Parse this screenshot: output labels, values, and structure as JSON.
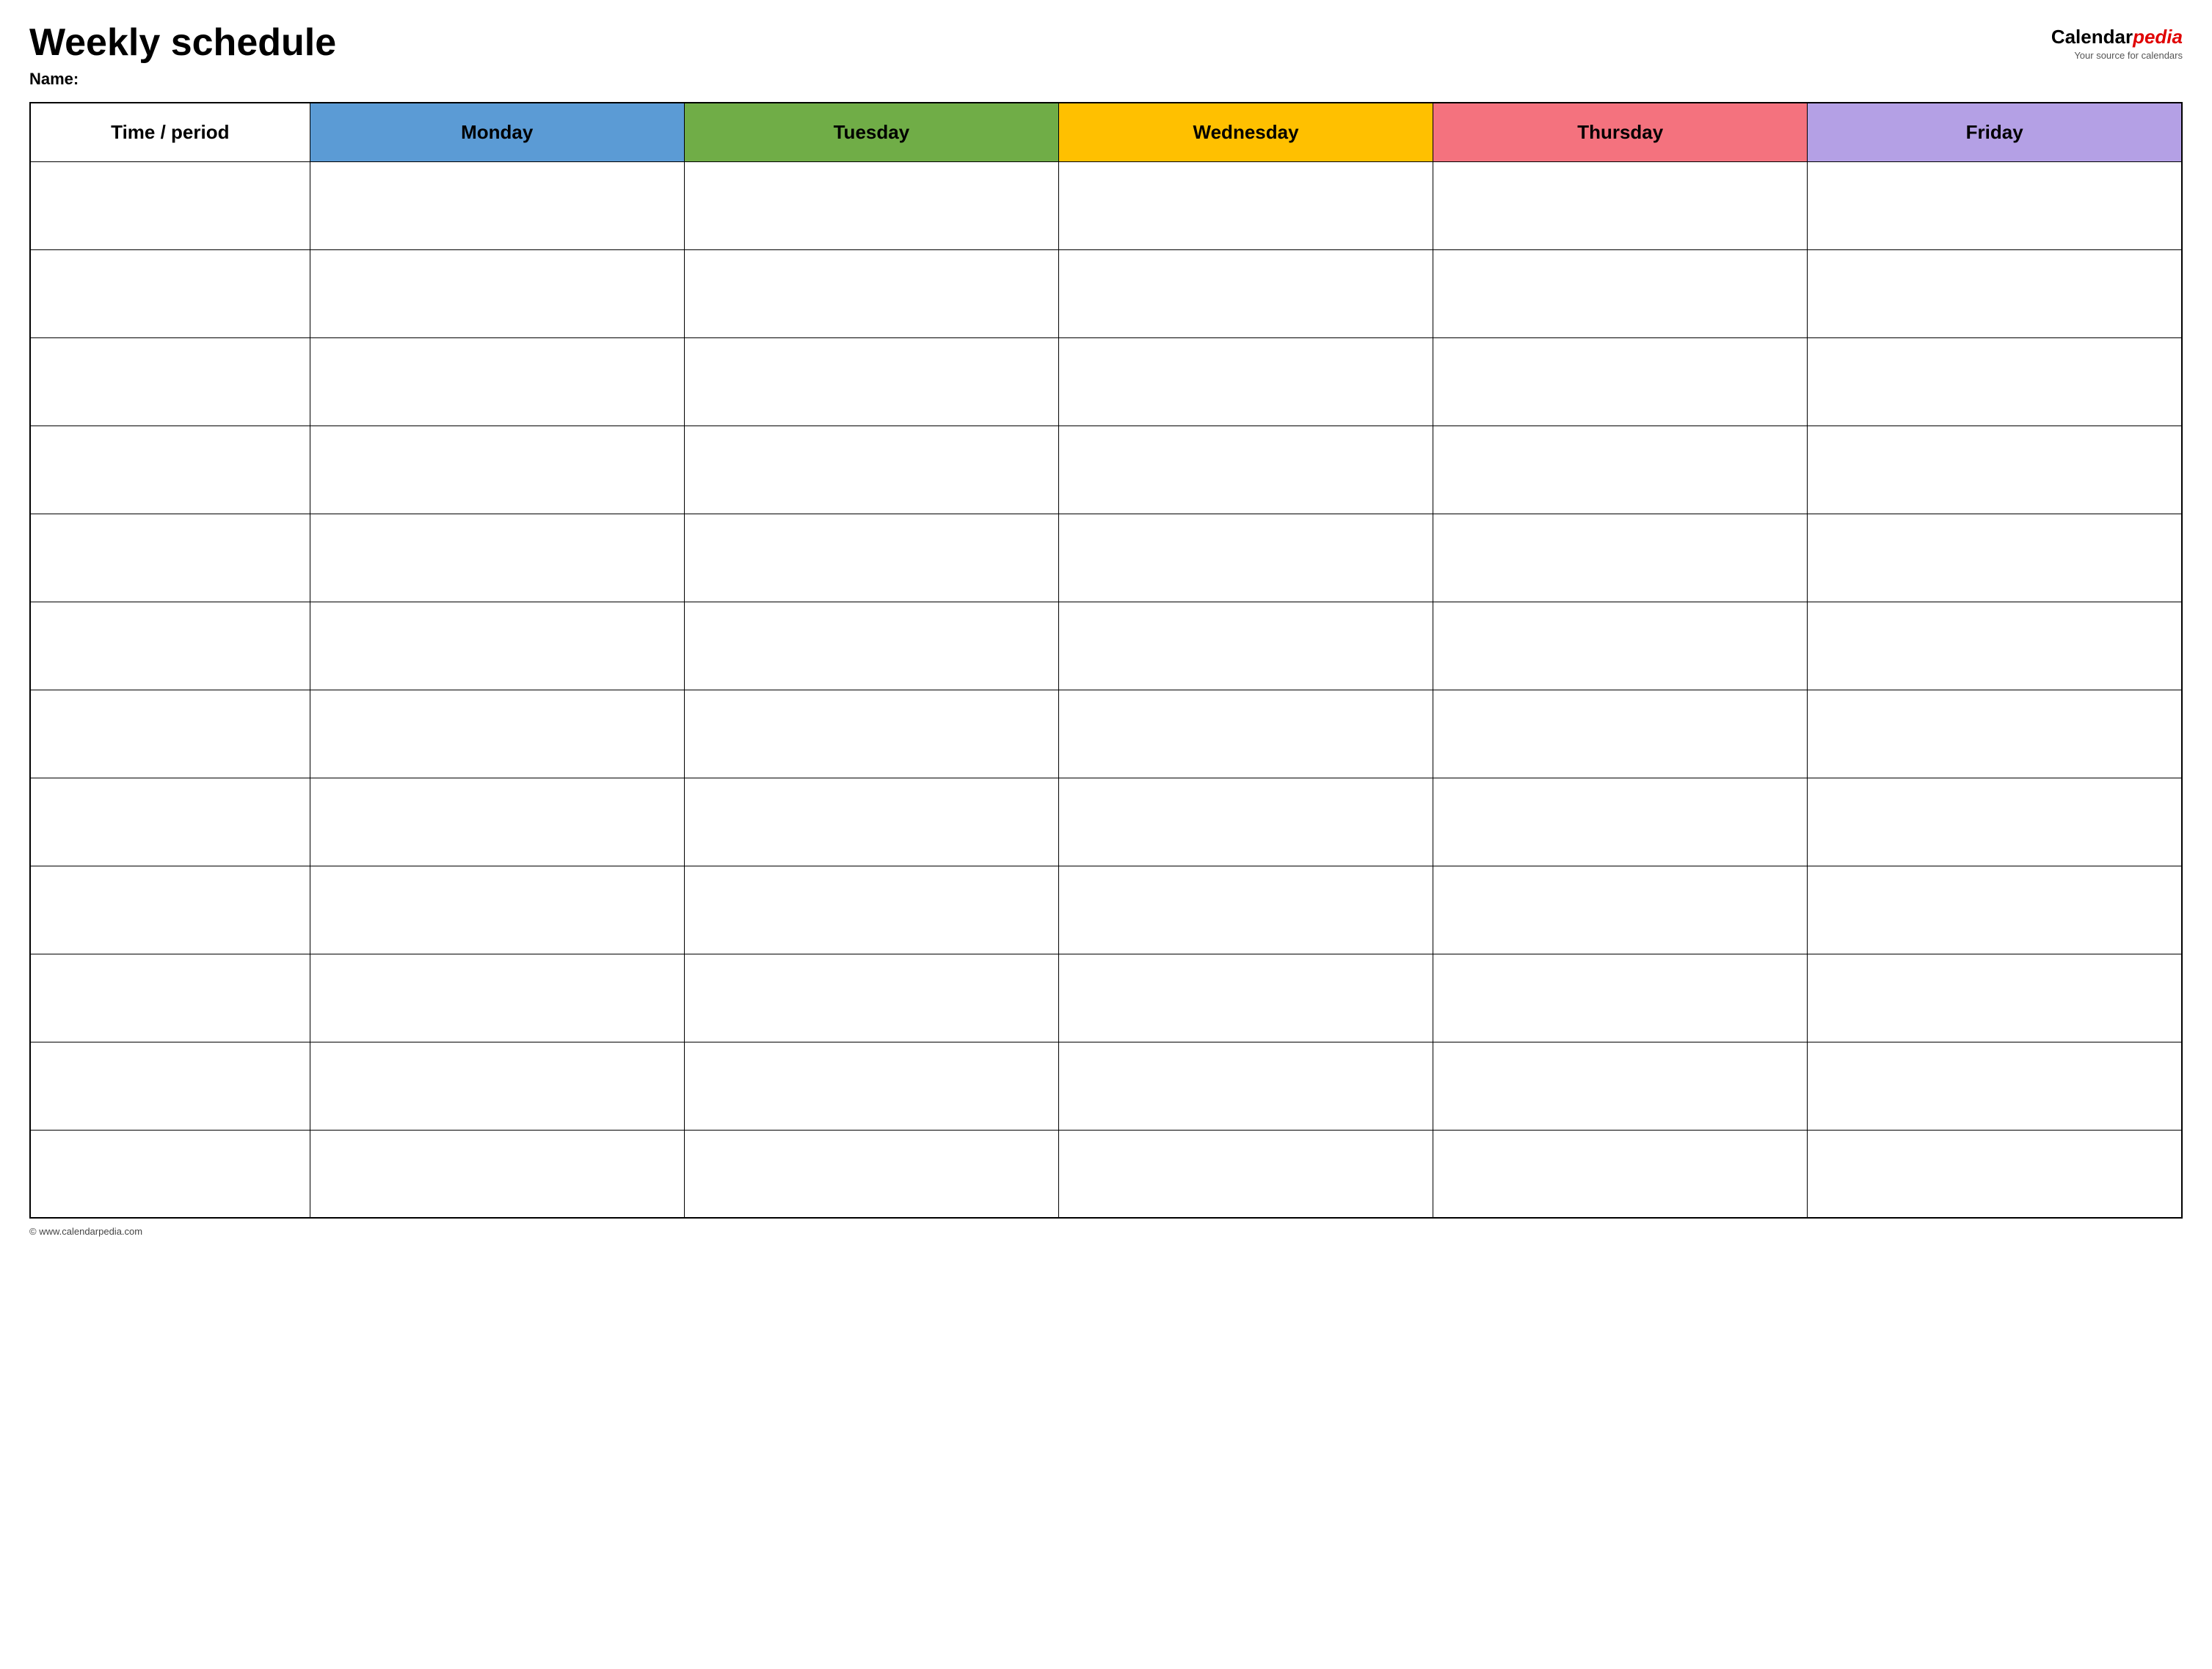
{
  "header": {
    "main_title": "Weekly schedule",
    "name_label": "Name:",
    "logo": {
      "text_calendar": "Calendar",
      "text_pedia": "pedia",
      "subtitle": "Your source for calendars"
    }
  },
  "table": {
    "columns": [
      {
        "id": "time",
        "label": "Time / period",
        "color": "#ffffff"
      },
      {
        "id": "monday",
        "label": "Monday",
        "color": "#5b9bd5"
      },
      {
        "id": "tuesday",
        "label": "Tuesday",
        "color": "#70ad47"
      },
      {
        "id": "wednesday",
        "label": "Wednesday",
        "color": "#ffc000"
      },
      {
        "id": "thursday",
        "label": "Thursday",
        "color": "#f4727e"
      },
      {
        "id": "friday",
        "label": "Friday",
        "color": "#b4a0e5"
      }
    ],
    "row_count": 12
  },
  "footer": {
    "copyright": "© www.calendarpedia.com"
  }
}
